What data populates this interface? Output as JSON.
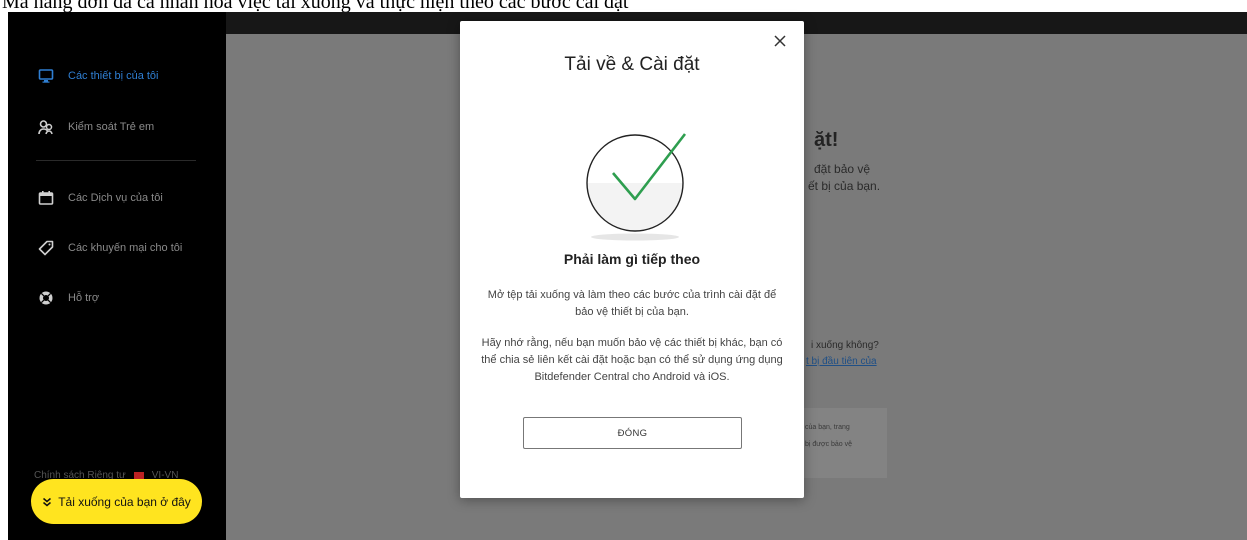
{
  "caption": "Mà hàng đơn đã cá nhân hóa việc tải xuống và thực hiện theo các bước cài đặt",
  "sidebar": {
    "items": [
      {
        "label": "Các thiết bị của tôi",
        "icon": "monitor-icon"
      },
      {
        "label": "Kiểm soát Trẻ em",
        "icon": "people-icon"
      },
      {
        "label": "Các Dịch vụ của tôi",
        "icon": "calendar-icon"
      },
      {
        "label": "Các khuyến mại cho tôi",
        "icon": "tag-icon"
      },
      {
        "label": "Hỗ trợ",
        "icon": "lifebuoy-icon"
      }
    ],
    "footer_link": "Chính sách Riêng tư",
    "footer_lang": "VI-VN",
    "download_pill": "Tải xuống của bạn ở đây"
  },
  "background": {
    "heading": "ặt!",
    "line1": "đặt bảo vệ",
    "line2": "ết bị của bạn.",
    "question": "i xuống không?",
    "link": "t bị đầu tiên của",
    "card_line1": "của bạn, trang",
    "card_line2": "bị được bảo vệ"
  },
  "modal": {
    "title": "Tải về & Cài đặt",
    "subtitle": "Phải làm gì tiếp theo",
    "para1": "Mở tệp tải xuống và làm theo các bước của trình cài đặt để bảo vệ thiết bị của bạn.",
    "para2": "Hãy nhớ rằng, nếu bạn muốn bảo vệ các thiết bị khác, bạn có thể chia sẻ liên kết cài đặt hoặc bạn có thể sử dụng ứng dụng Bitdefender Central cho Android và iOS.",
    "close_button": "ĐÓNG"
  },
  "colors": {
    "accent_yellow": "#ffe41f",
    "active_blue": "#2f7fd3",
    "check_green": "#2e9e4f"
  }
}
